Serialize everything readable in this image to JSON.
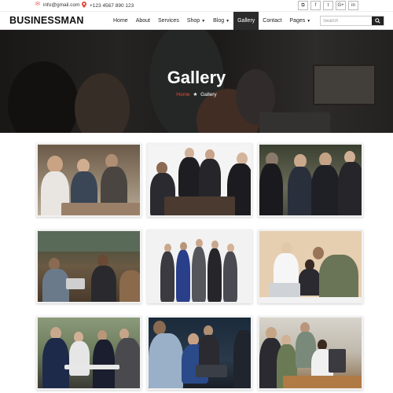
{
  "topbar": {
    "email": "info@gmail.com",
    "phone": "+123 4567 890 123",
    "socials": [
      "rss-icon",
      "facebook-icon",
      "twitter-icon",
      "google-plus-icon",
      "linkedin-icon"
    ],
    "social_glyphs": [
      "⧉",
      "f",
      "t",
      "G+",
      "in"
    ]
  },
  "nav": {
    "logo": "BUSINESSMAN",
    "items": [
      {
        "label": "Home",
        "dropdown": false
      },
      {
        "label": "About",
        "dropdown": false
      },
      {
        "label": "Services",
        "dropdown": false
      },
      {
        "label": "Shop",
        "dropdown": true
      },
      {
        "label": "Blog",
        "dropdown": true
      },
      {
        "label": "Gallery",
        "dropdown": false,
        "active": true
      },
      {
        "label": "Contact",
        "dropdown": false
      },
      {
        "label": "Pages",
        "dropdown": true
      }
    ],
    "search_placeholder": "Search"
  },
  "hero": {
    "title": "Gallery",
    "breadcrumb_home": "Home",
    "breadcrumb_sep": "★",
    "breadcrumb_current": "Gallery"
  },
  "gallery": {
    "images": [
      "Team meeting at office table",
      "Business people shaking hands",
      "Press conference with businessmen",
      "Coworkers in office lounge",
      "Business team standing",
      "Colleagues at laptop",
      "Business lunch outdoors",
      "Team working on laptops",
      "Coworkers in office"
    ]
  },
  "colors": {
    "accent": "#e74c3c",
    "dark": "#2b2b2b"
  }
}
